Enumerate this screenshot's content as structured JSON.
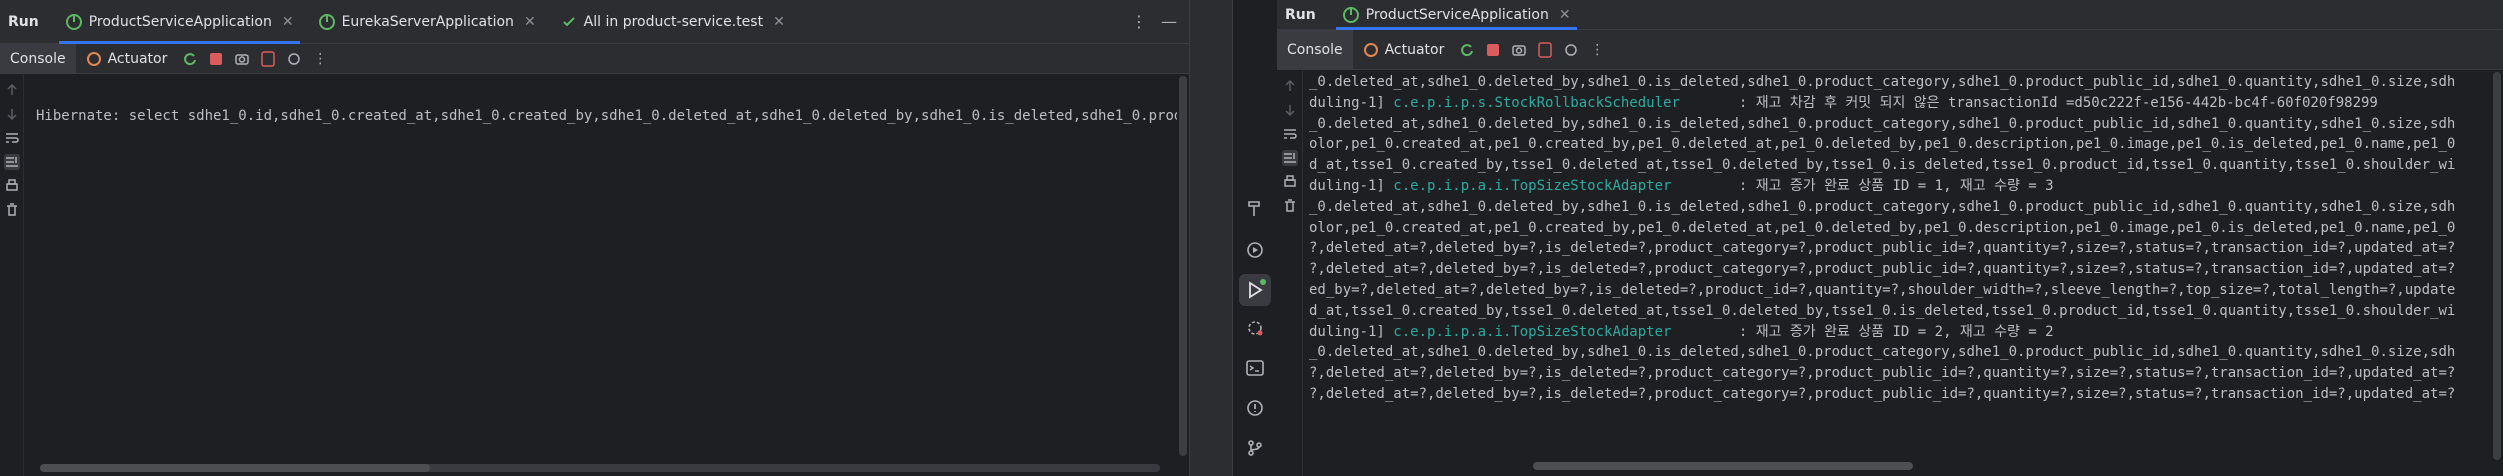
{
  "left": {
    "run_label": "Run",
    "tabs": [
      {
        "label": "ProductServiceApplication",
        "active": true
      },
      {
        "label": "EurekaServerApplication",
        "active": false
      },
      {
        "label": "All in product-service.test",
        "active": false
      }
    ],
    "toolbar": {
      "console_label": "Console",
      "actuator_label": "Actuator"
    },
    "lines": [
      "Hibernate: select sdhe1_0.id,sdhe1_0.created_at,sdhe1_0.created_by,sdhe1_0.deleted_at,sdhe1_0.deleted_by,sdhe1_0.is_deleted,sdhe1_0.prod"
    ]
  },
  "right": {
    "run_label": "Run",
    "tabs": [
      {
        "label": "ProductServiceApplication",
        "active": true
      }
    ],
    "toolbar": {
      "console_label": "Console",
      "actuator_label": "Actuator"
    },
    "lines": [
      {
        "text": "_0.deleted_at,sdhe1_0.deleted_by,sdhe1_0.is_deleted,sdhe1_0.product_category,sdhe1_0.product_public_id,sdhe1_0.quantity,sdhe1_0.size,sdh"
      },
      {
        "prefix": "duling-1] ",
        "logger": "c.e.p.i.p.s.StockRollbackScheduler",
        "suffix": "       : 재고 차감 후 커밋 되지 않은 transactionId =d50c222f-e156-442b-bc4f-60f020f98299"
      },
      {
        "text": "_0.deleted_at,sdhe1_0.deleted_by,sdhe1_0.is_deleted,sdhe1_0.product_category,sdhe1_0.product_public_id,sdhe1_0.quantity,sdhe1_0.size,sdh"
      },
      {
        "text": "olor,pe1_0.created_at,pe1_0.created_by,pe1_0.deleted_at,pe1_0.deleted_by,pe1_0.description,pe1_0.image,pe1_0.is_deleted,pe1_0.name,pe1_0"
      },
      {
        "text": "d_at,tsse1_0.created_by,tsse1_0.deleted_at,tsse1_0.deleted_by,tsse1_0.is_deleted,tsse1_0.product_id,tsse1_0.quantity,tsse1_0.shoulder_wi"
      },
      {
        "prefix": "duling-1] ",
        "logger": "c.e.p.i.p.a.i.TopSizeStockAdapter",
        "suffix": "        : 재고 증가 완료 상품 ID = 1, 재고 수량 = 3"
      },
      {
        "text": "_0.deleted_at,sdhe1_0.deleted_by,sdhe1_0.is_deleted,sdhe1_0.product_category,sdhe1_0.product_public_id,sdhe1_0.quantity,sdhe1_0.size,sdh"
      },
      {
        "text": "olor,pe1_0.created_at,pe1_0.created_by,pe1_0.deleted_at,pe1_0.deleted_by,pe1_0.description,pe1_0.image,pe1_0.is_deleted,pe1_0.name,pe1_0"
      },
      {
        "text": "?,deleted_at=?,deleted_by=?,is_deleted=?,product_category=?,product_public_id=?,quantity=?,size=?,status=?,transaction_id=?,updated_at=?"
      },
      {
        "text": "?,deleted_at=?,deleted_by=?,is_deleted=?,product_category=?,product_public_id=?,quantity=?,size=?,status=?,transaction_id=?,updated_at=?"
      },
      {
        "text": "ed_by=?,deleted_at=?,deleted_by=?,is_deleted=?,product_id=?,quantity=?,shoulder_width=?,sleeve_length=?,top_size=?,total_length=?,update"
      },
      {
        "text": "d_at,tsse1_0.created_by,tsse1_0.deleted_at,tsse1_0.deleted_by,tsse1_0.is_deleted,tsse1_0.product_id,tsse1_0.quantity,tsse1_0.shoulder_wi"
      },
      {
        "prefix": "duling-1] ",
        "logger": "c.e.p.i.p.a.i.TopSizeStockAdapter",
        "suffix": "        : 재고 증가 완료 상품 ID = 2, 재고 수량 = 2"
      },
      {
        "text": "_0.deleted_at,sdhe1_0.deleted_by,sdhe1_0.is_deleted,sdhe1_0.product_category,sdhe1_0.product_public_id,sdhe1_0.quantity,sdhe1_0.size,sdh"
      },
      {
        "text": "?,deleted_at=?,deleted_by=?,is_deleted=?,product_category=?,product_public_id=?,quantity=?,size=?,status=?,transaction_id=?,updated_at=?"
      },
      {
        "text": "?,deleted_at=?,deleted_by=?,is_deleted=?,product_category=?,product_public_id=?,quantity=?,size=?,status=?,transaction_id=?,updated_at=?"
      }
    ]
  },
  "colors": {
    "accent": "#3574f0",
    "logger": "#2aaca0",
    "stop": "#db5c5c",
    "run_green": "#5fb865"
  },
  "icons": [
    "spring-boot-icon",
    "restart-icon",
    "stop-icon",
    "camera-icon",
    "debug-icon",
    "more-icon",
    "up-arrow-icon",
    "down-arrow-icon",
    "soft-wrap-icon",
    "scroll-to-end-icon",
    "print-icon",
    "trash-icon",
    "hammer-icon",
    "debug-run-icon",
    "run-icon",
    "services-icon",
    "terminal-icon",
    "problems-icon",
    "git-icon"
  ]
}
